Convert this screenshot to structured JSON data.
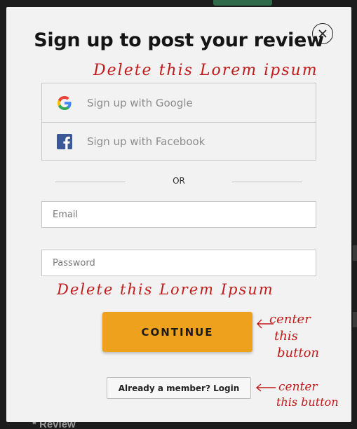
{
  "modal": {
    "title": "Sign up to post your review",
    "close_label": "×"
  },
  "social": {
    "google_label": "Sign up with Google",
    "facebook_label": "Sign up with Facebook"
  },
  "divider": {
    "text": "OR"
  },
  "form": {
    "email_placeholder": "Email",
    "password_placeholder": "Password"
  },
  "buttons": {
    "continue_label": "CONTINUE",
    "login_label": "Already a member? Login"
  },
  "annotations": {
    "delete_1": "Delete this Lorem ipsum",
    "delete_2": "Delete this Lorem Ipsum",
    "center_button_1_lines": [
      "center",
      "this",
      "button"
    ],
    "center_button_2_lines": [
      "center",
      "this button"
    ]
  },
  "background": {
    "review_label": "* Review"
  },
  "colors": {
    "accent": "#eea11d",
    "annotation": "#c21b1b",
    "facebook": "#3b5998"
  }
}
